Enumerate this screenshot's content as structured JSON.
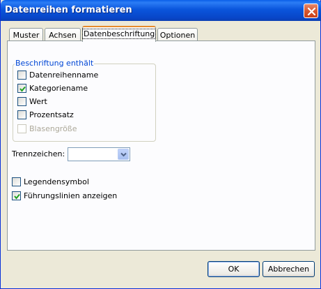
{
  "window": {
    "title": "Datenreihen formatieren"
  },
  "tabs": [
    {
      "label": "Muster",
      "active": false
    },
    {
      "label": "Achsen",
      "active": false
    },
    {
      "label": "Datenbeschriftung",
      "active": true
    },
    {
      "label": "Optionen",
      "active": false
    }
  ],
  "label_group": {
    "title": "Beschriftung enthält",
    "items": [
      {
        "label": "Datenreihenname",
        "checked": false,
        "enabled": true
      },
      {
        "label": "Kategoriename",
        "checked": true,
        "enabled": true
      },
      {
        "label": "Wert",
        "checked": false,
        "enabled": true
      },
      {
        "label": "Prozentsatz",
        "checked": false,
        "enabled": true
      },
      {
        "label": "Blasengröße",
        "checked": false,
        "enabled": false
      }
    ]
  },
  "separator": {
    "label": "Trennzeichen:",
    "value": ""
  },
  "legend_key": {
    "label": "Legendensymbol",
    "checked": false
  },
  "leader_lines": {
    "label": "Führungslinien anzeigen",
    "checked": true
  },
  "buttons": {
    "ok": "OK",
    "cancel": "Abbrechen"
  },
  "colors": {
    "titlebar": "#0a55dc",
    "group_title": "#0046d5",
    "active_tab_highlight": "#e68b2c"
  }
}
